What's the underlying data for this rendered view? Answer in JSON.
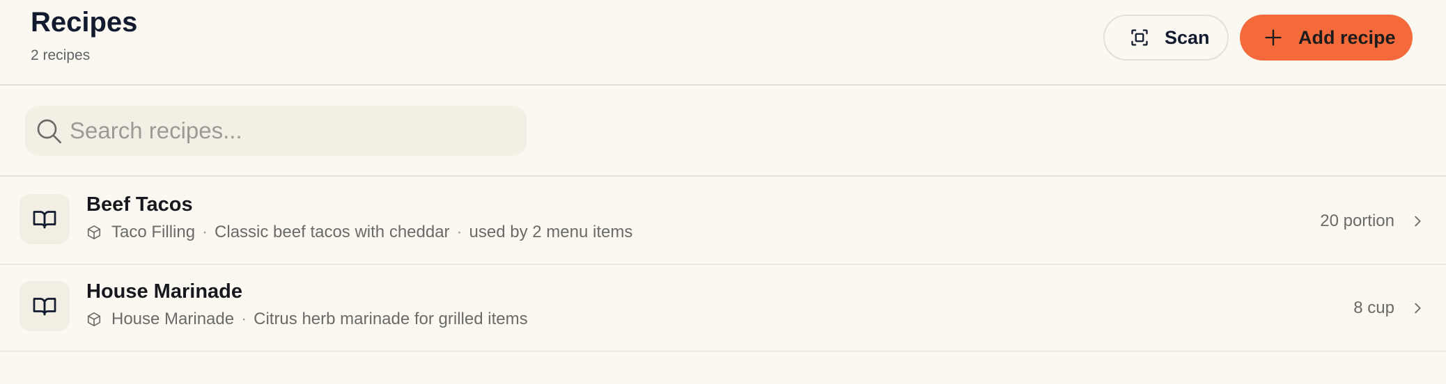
{
  "header": {
    "title": "Recipes",
    "subtitle": "2 recipes",
    "scan_label": "Scan",
    "add_label": "Add recipe",
    "accent_color": "#f56a3b"
  },
  "search": {
    "placeholder": "Search recipes...",
    "value": ""
  },
  "recipes": [
    {
      "title": "Beef Tacos",
      "category": "Taco Filling",
      "description": "Classic beef tacos with cheddar",
      "usage": "used by 2 menu items",
      "yield": "20 portion",
      "icon": "book-open-icon"
    },
    {
      "title": "House Marinade",
      "category": "House Marinade",
      "description": "Citrus herb marinade for grilled items",
      "yield": "8 cup",
      "icon": "book-open-icon"
    }
  ]
}
